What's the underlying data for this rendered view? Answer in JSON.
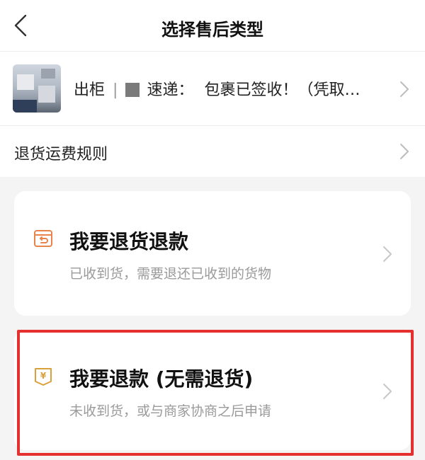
{
  "header": {
    "title": "选择售后类型",
    "back_icon": "chevron-left-icon"
  },
  "order": {
    "prefix": "出柜",
    "separator": "|",
    "courier_tail": "速递：",
    "status": "包裹已签收！（凭取…"
  },
  "rules": {
    "label": "退货运费规则"
  },
  "options": [
    {
      "title": "我要退货退款",
      "subtitle": "已收到货，需要退还已收到的货物",
      "icon": "return-package-icon"
    },
    {
      "title": "我要退款 (无需退货)",
      "subtitle": "未收到货，或与商家协商之后申请",
      "icon": "refund-yen-icon"
    }
  ],
  "colors": {
    "accent": "#e8834a",
    "highlight": "#e5302f",
    "background": "#f4f4f4"
  }
}
